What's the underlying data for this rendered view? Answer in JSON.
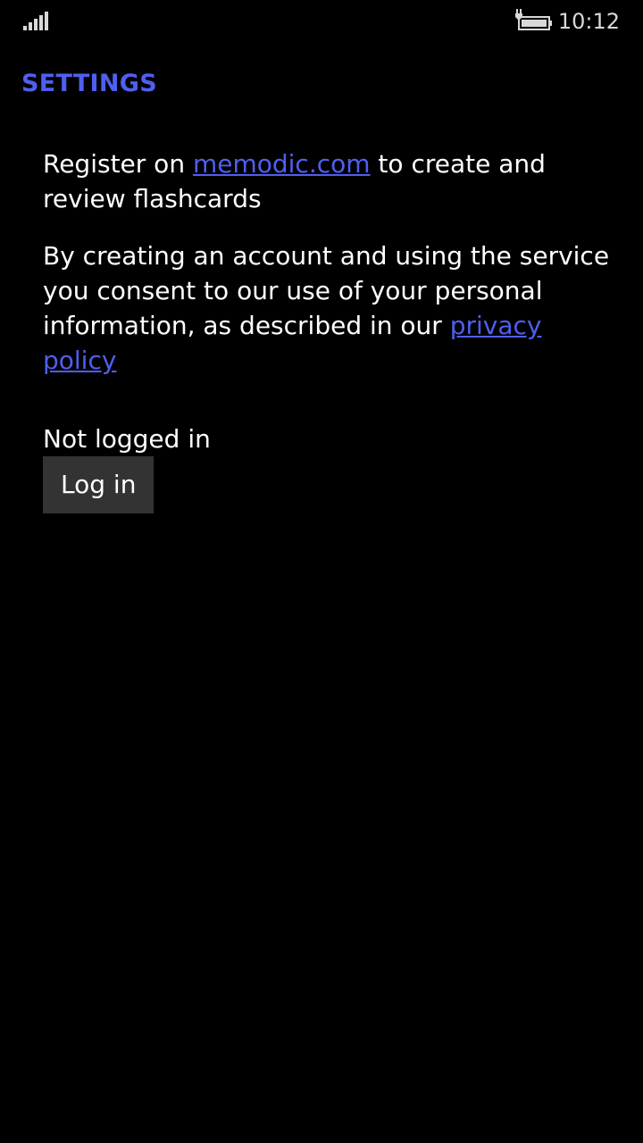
{
  "theme": {
    "accent": "#4f5ff0",
    "background": "#000000",
    "button_bg": "#333333"
  },
  "status_bar": {
    "signal_icon": "cellular-signal-icon",
    "battery_icon": "battery-charging-icon",
    "time": "10:12"
  },
  "page": {
    "title": "SETTINGS"
  },
  "register": {
    "prefix": "Register on ",
    "link": "memodic.com",
    "suffix": " to create and review flashcards"
  },
  "consent": {
    "text": "By creating an account and using the service you consent to our use of your personal information, as described in our ",
    "link": "privacy policy"
  },
  "account": {
    "status": "Not logged in",
    "login_label": "Log in"
  }
}
